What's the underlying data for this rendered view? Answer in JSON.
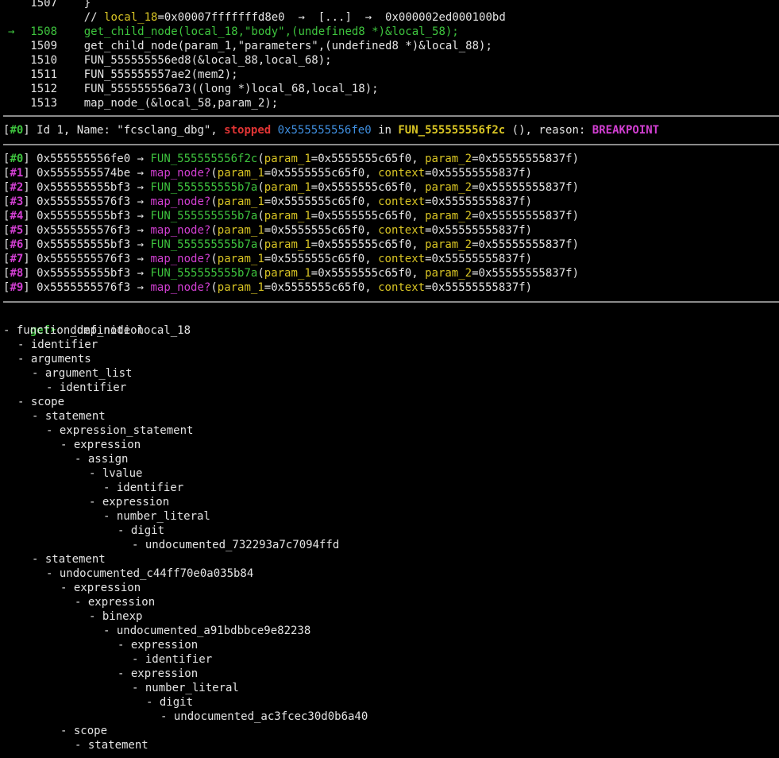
{
  "source": {
    "lines": [
      {
        "marker": "",
        "num": "1507",
        "code": "}"
      },
      {
        "marker": "",
        "num": "",
        "comment_prefix": "// ",
        "var": "local_18",
        "comment_rest": "=0x00007fffffffd8e0  →  [...]  →  0x000002ed000100bd"
      },
      {
        "marker": "→",
        "num": "1508",
        "code": "get_child_node(local_18,\"body\",(undefined8 *)&local_58);"
      },
      {
        "marker": "",
        "num": "1509",
        "code": "get_child_node(param_1,\"parameters\",(undefined8 *)&local_88);"
      },
      {
        "marker": "",
        "num": "1510",
        "code": "FUN_555555556ed8(&local_88,local_68);"
      },
      {
        "marker": "",
        "num": "1511",
        "code": "FUN_555555557ae2(mem2);"
      },
      {
        "marker": "",
        "num": "1512",
        "code": "FUN_555555556a73((long *)local_68,local_18);"
      },
      {
        "marker": "",
        "num": "1513",
        "code": "map_node_(&local_58,param_2);"
      }
    ]
  },
  "threads": {
    "index": "#0",
    "id_text": " Id 1, Name: \"fcsclang_dbg\", ",
    "state": "stopped",
    "address": "0x555555556fe0",
    "in_text": " in ",
    "function": "FUN_555555556f2c",
    "reason_prefix": " (), reason: ",
    "reason": "BREAKPOINT"
  },
  "trace": [
    {
      "idx": "#0",
      "addr": "0x555555556fe0",
      "func": "FUN_555555556f2c",
      "p1": "param_1",
      "v1": "0x5555555c65f0",
      "p2": "param_2",
      "v2": "0x55555555837f"
    },
    {
      "idx": "#1",
      "addr": "0x5555555574be",
      "func": "map_node?",
      "p1": "param_1",
      "v1": "0x5555555c65f0",
      "p2": "context",
      "v2": "0x55555555837f"
    },
    {
      "idx": "#2",
      "addr": "0x555555555bf3",
      "func": "FUN_555555555b7a",
      "p1": "param_1",
      "v1": "0x5555555c65f0",
      "p2": "param_2",
      "v2": "0x55555555837f"
    },
    {
      "idx": "#3",
      "addr": "0x5555555576f3",
      "func": "map_node?",
      "p1": "param_1",
      "v1": "0x5555555c65f0",
      "p2": "context",
      "v2": "0x55555555837f"
    },
    {
      "idx": "#4",
      "addr": "0x555555555bf3",
      "func": "FUN_555555555b7a",
      "p1": "param_1",
      "v1": "0x5555555c65f0",
      "p2": "param_2",
      "v2": "0x55555555837f"
    },
    {
      "idx": "#5",
      "addr": "0x5555555576f3",
      "func": "map_node?",
      "p1": "param_1",
      "v1": "0x5555555c65f0",
      "p2": "context",
      "v2": "0x55555555837f"
    },
    {
      "idx": "#6",
      "addr": "0x555555555bf3",
      "func": "FUN_555555555b7a",
      "p1": "param_1",
      "v1": "0x5555555c65f0",
      "p2": "param_2",
      "v2": "0x55555555837f"
    },
    {
      "idx": "#7",
      "addr": "0x5555555576f3",
      "func": "map_node?",
      "p1": "param_1",
      "v1": "0x5555555c65f0",
      "p2": "context",
      "v2": "0x55555555837f"
    },
    {
      "idx": "#8",
      "addr": "0x555555555bf3",
      "func": "FUN_555555555b7a",
      "p1": "param_1",
      "v1": "0x5555555c65f0",
      "p2": "param_2",
      "v2": "0x55555555837f"
    },
    {
      "idx": "#9",
      "addr": "0x5555555576f3",
      "func": "map_node?",
      "p1": "param_1",
      "v1": "0x5555555c65f0",
      "p2": "context",
      "v2": "0x55555555837f"
    }
  ],
  "prompt": {
    "label": "gef➤",
    "command": "  dump_node local_18"
  },
  "tree": [
    {
      "depth": 0,
      "text": "- function_definition"
    },
    {
      "depth": 1,
      "text": "- identifier"
    },
    {
      "depth": 1,
      "text": "- arguments"
    },
    {
      "depth": 2,
      "text": "- argument_list"
    },
    {
      "depth": 3,
      "text": "- identifier"
    },
    {
      "depth": 1,
      "text": "- scope"
    },
    {
      "depth": 2,
      "text": "- statement"
    },
    {
      "depth": 3,
      "text": "- expression_statement"
    },
    {
      "depth": 4,
      "text": "- expression"
    },
    {
      "depth": 5,
      "text": "- assign"
    },
    {
      "depth": 6,
      "text": "- lvalue"
    },
    {
      "depth": 7,
      "text": "- identifier"
    },
    {
      "depth": 6,
      "text": "- expression"
    },
    {
      "depth": 7,
      "text": "- number_literal"
    },
    {
      "depth": 8,
      "text": "- digit"
    },
    {
      "depth": 9,
      "text": "- undocumented_732293a7c7094ffd"
    },
    {
      "depth": 2,
      "text": "- statement"
    },
    {
      "depth": 3,
      "text": "- undocumented_c44ff70e0a035b84"
    },
    {
      "depth": 4,
      "text": "- expression"
    },
    {
      "depth": 5,
      "text": "- expression"
    },
    {
      "depth": 6,
      "text": "- binexp"
    },
    {
      "depth": 7,
      "text": "- undocumented_a91bdbbce9e82238"
    },
    {
      "depth": 8,
      "text": "- expression"
    },
    {
      "depth": 9,
      "text": "- identifier"
    },
    {
      "depth": 8,
      "text": "- expression"
    },
    {
      "depth": 9,
      "text": "- number_literal"
    },
    {
      "depth": 10,
      "text": "- digit"
    },
    {
      "depth": 11,
      "text": "- undocumented_ac3fcec30d0b6a40"
    },
    {
      "depth": 4,
      "text": "- scope"
    },
    {
      "depth": 5,
      "text": "- statement"
    }
  ],
  "colors": {
    "green": "#3ec43e",
    "yellow": "#d8c424",
    "magenta": "#d23fd2",
    "red": "#e03434",
    "blue": "#3f8fe0",
    "text": "#e4e4e4",
    "background": "#000000"
  }
}
